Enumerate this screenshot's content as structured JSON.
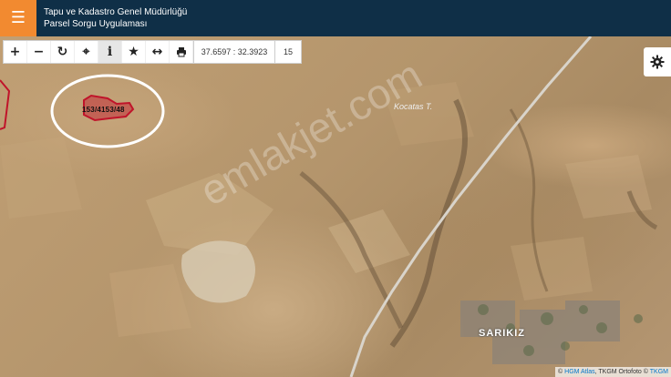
{
  "header": {
    "menu_icon": "hamburger-icon",
    "title_line1": "Tapu ve Kadastro Genel Müdürlüğü",
    "title_line2": "Parsel Sorgu Uygulaması",
    "colors": {
      "bar": "#0f2f47",
      "menu": "#f28a30"
    }
  },
  "toolbar": {
    "buttons": [
      {
        "name": "zoom-in",
        "icon": "plus-icon"
      },
      {
        "name": "zoom-out",
        "icon": "minus-icon"
      },
      {
        "name": "refresh",
        "icon": "refresh-icon"
      },
      {
        "name": "locate",
        "icon": "crosshair-icon"
      },
      {
        "name": "info",
        "icon": "info-icon",
        "active": true
      },
      {
        "name": "favorite",
        "icon": "star-icon"
      },
      {
        "name": "measure",
        "icon": "arrows-horizontal-icon"
      },
      {
        "name": "print",
        "icon": "printer-icon"
      }
    ],
    "coordinates": "37.6597 : 32.3923",
    "zoom_level": "15"
  },
  "map": {
    "parcel_label": "153/4153/48",
    "place_label": "Kocatas T.",
    "town_label": "SARIKIZ",
    "watermark": "emlakjet.com",
    "parcel_color": "#c0142a",
    "highlight_circle_color": "#ffffff"
  },
  "settings": {
    "icon": "gear-icon"
  },
  "attribution": {
    "prefix": "©",
    "link1": "HGM Atlas",
    "middle": ", TKGM Ortofoto ©",
    "link2": "TKGM"
  }
}
